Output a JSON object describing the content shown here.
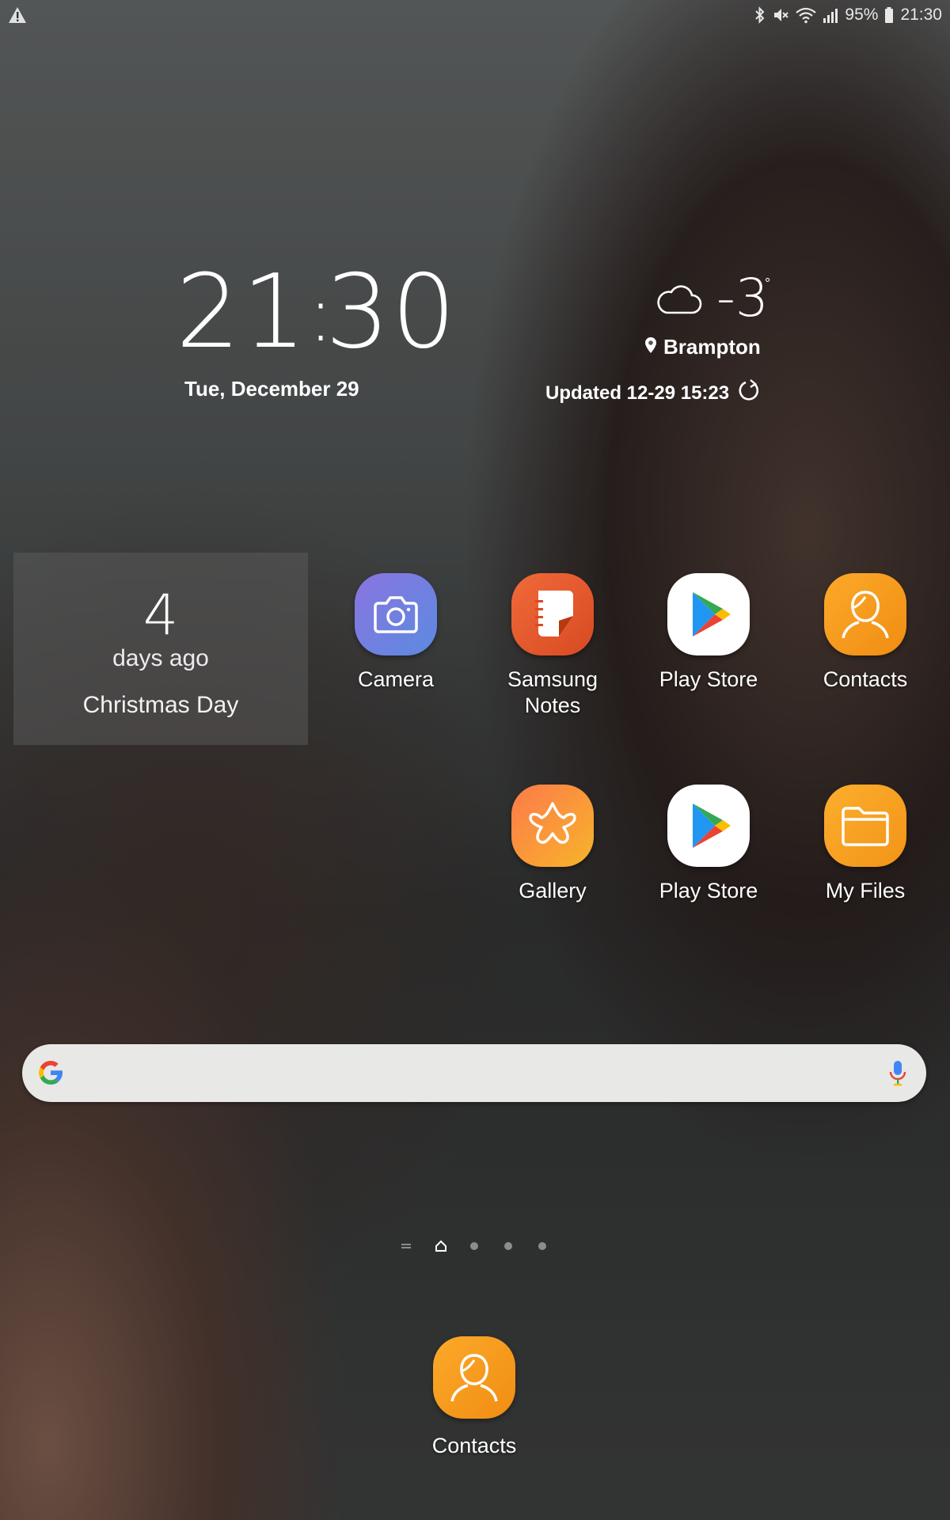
{
  "status_bar": {
    "battery_percent": "95%",
    "time": "21:30",
    "icons": [
      "alert-icon",
      "bluetooth-icon",
      "mute-icon",
      "wifi-icon",
      "signal-icon",
      "battery-icon"
    ]
  },
  "clock_widget": {
    "hours": "21",
    "minutes": "30",
    "date": "Tue, December 29"
  },
  "weather_widget": {
    "temperature": "-3",
    "degree": "°",
    "location": "Brampton",
    "updated": "Updated 12-29 15:23",
    "icons": [
      "cloud-icon",
      "location-pin-icon",
      "refresh-icon"
    ]
  },
  "dday_widget": {
    "count": "4",
    "unit": "days ago",
    "event": "Christmas Day"
  },
  "apps": {
    "camera": "Camera",
    "samsung_notes_line1": "Samsung",
    "samsung_notes_line2": "Notes",
    "play_store_1": "Play Store",
    "contacts": "Contacts",
    "gallery": "Gallery",
    "play_store_2": "Play Store",
    "my_files": "My Files"
  },
  "dock": {
    "contacts": "Contacts"
  },
  "search_bar": {
    "icons": [
      "google-g-icon",
      "microphone-icon"
    ]
  },
  "pager": {
    "pages": 4,
    "current": 1
  },
  "colors": {
    "orange_icon": "#f79a1e",
    "camera_icon": "#6e7fd6",
    "notes_icon": "#e2552c"
  }
}
